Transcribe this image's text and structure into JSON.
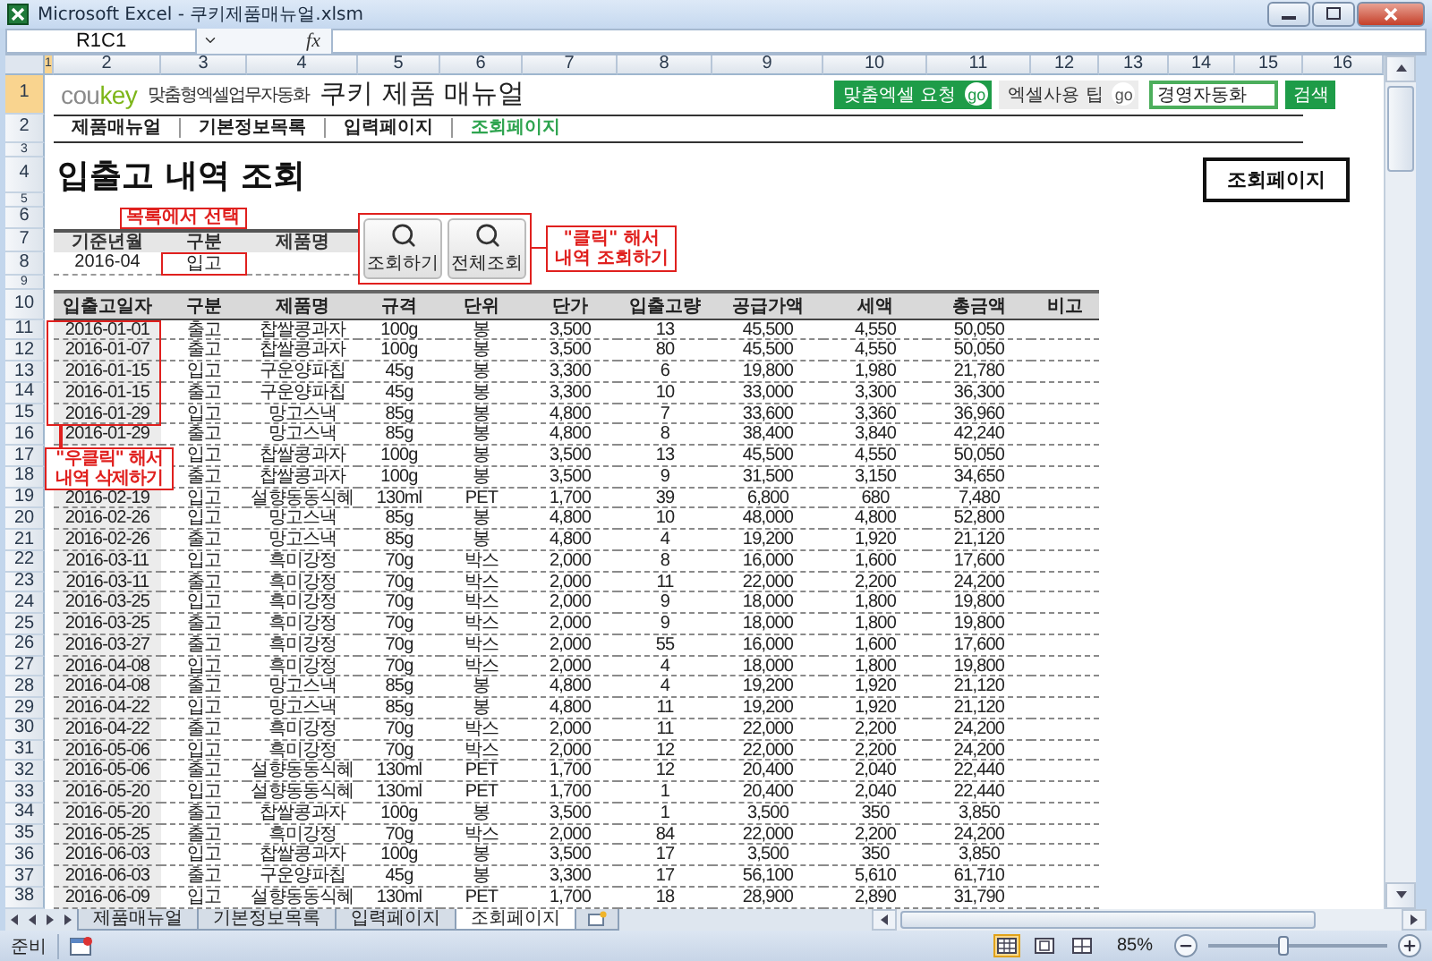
{
  "window": {
    "title": "Microsoft Excel - 쿠키제품매뉴얼.xlsm"
  },
  "formula_bar": {
    "name_box": "R1C1",
    "fx": "fx"
  },
  "column_headers": [
    {
      "label": "1",
      "selected": true
    },
    {
      "label": "2",
      "selected": false
    },
    {
      "label": "3",
      "selected": false
    },
    {
      "label": "4",
      "selected": false
    },
    {
      "label": "5",
      "selected": false
    },
    {
      "label": "6",
      "selected": false
    },
    {
      "label": "7",
      "selected": false
    },
    {
      "label": "8",
      "selected": false
    },
    {
      "label": "9",
      "selected": false
    },
    {
      "label": "10",
      "selected": false
    },
    {
      "label": "11",
      "selected": false
    },
    {
      "label": "12",
      "selected": false
    },
    {
      "label": "13",
      "selected": false
    },
    {
      "label": "14",
      "selected": false
    },
    {
      "label": "15",
      "selected": false
    },
    {
      "label": "16",
      "selected": false
    }
  ],
  "row_headers": [
    {
      "label": "1",
      "selected": true
    },
    {
      "label": "2",
      "selected": false
    },
    {
      "label": "3",
      "selected": false
    },
    {
      "label": "4",
      "selected": false
    },
    {
      "label": "5",
      "selected": false
    },
    {
      "label": "6",
      "selected": false
    },
    {
      "label": "7",
      "selected": false
    },
    {
      "label": "8",
      "selected": false
    },
    {
      "label": "9",
      "selected": false
    },
    {
      "label": "10",
      "selected": false
    },
    {
      "label": "11",
      "selected": false
    },
    {
      "label": "12",
      "selected": false
    },
    {
      "label": "13",
      "selected": false
    },
    {
      "label": "14",
      "selected": false
    },
    {
      "label": "15",
      "selected": false
    },
    {
      "label": "16",
      "selected": false
    },
    {
      "label": "17",
      "selected": false
    },
    {
      "label": "18",
      "selected": false
    },
    {
      "label": "19",
      "selected": false
    },
    {
      "label": "20",
      "selected": false
    },
    {
      "label": "21",
      "selected": false
    },
    {
      "label": "22",
      "selected": false
    },
    {
      "label": "23",
      "selected": false
    },
    {
      "label": "24",
      "selected": false
    },
    {
      "label": "25",
      "selected": false
    },
    {
      "label": "26",
      "selected": false
    },
    {
      "label": "27",
      "selected": false
    },
    {
      "label": "28",
      "selected": false
    },
    {
      "label": "29",
      "selected": false
    },
    {
      "label": "30",
      "selected": false
    },
    {
      "label": "31",
      "selected": false
    },
    {
      "label": "32",
      "selected": false
    },
    {
      "label": "33",
      "selected": false
    },
    {
      "label": "34",
      "selected": false
    },
    {
      "label": "35",
      "selected": false
    },
    {
      "label": "36",
      "selected": false
    },
    {
      "label": "37",
      "selected": false
    },
    {
      "label": "38",
      "selected": false
    }
  ],
  "brand": {
    "logo_part_1": "cou",
    "logo_part_2": "key",
    "tagline": "맞춤형엑셀업무자동화",
    "title": "쿠키 제품 매뉴얼"
  },
  "header_buttons": [
    {
      "kind": "green",
      "label": "맞춤엑셀 요청",
      "badge": "go"
    },
    {
      "kind": "gray",
      "label": "엑셀사용 팁",
      "badge": "go"
    }
  ],
  "search": {
    "value": "경영자동화",
    "button": "검색"
  },
  "nav": [
    {
      "label": "제품매뉴얼",
      "selected": false
    },
    {
      "label": "기본정보목록",
      "selected": false
    },
    {
      "label": "입력페이지",
      "selected": false
    },
    {
      "label": "조회페이지",
      "selected": true
    }
  ],
  "page_title": "입출고 내역 조회",
  "page_button": "조회페이지",
  "filter": {
    "fields": [
      {
        "header": "기준년월",
        "value": "2016-04",
        "highlighted": false
      },
      {
        "header": "구분",
        "value": "입고",
        "highlighted": true
      },
      {
        "header": "제품명",
        "highlighted": false
      }
    ],
    "note": "목록에서 선택"
  },
  "search_buttons": [
    {
      "label": "조회하기"
    },
    {
      "label": "전체조회"
    }
  ],
  "click_note": "\"클릭\" 해서\n내역 조회하기",
  "table": {
    "columns": [
      "입출고일자",
      "구분",
      "제품명",
      "규격",
      "단위",
      "단가",
      "입출고량",
      "공급가액",
      "세액",
      "총금액",
      "비고"
    ],
    "rows": [
      {
        "cells": [
          "2016-01-01",
          "출고",
          "찹쌀콩과자",
          "100g",
          "봉",
          "3,500",
          "13",
          "45,500",
          "4,550",
          "50,050"
        ]
      },
      {
        "cells": [
          "2016-01-07",
          "출고",
          "찹쌀콩과자",
          "100g",
          "봉",
          "3,500",
          "80",
          "45,500",
          "4,550",
          "50,050"
        ]
      },
      {
        "cells": [
          "2016-01-15",
          "입고",
          "구운양파칩",
          "45g",
          "봉",
          "3,300",
          "6",
          "19,800",
          "1,980",
          "21,780"
        ]
      },
      {
        "cells": [
          "2016-01-15",
          "출고",
          "구운양파칩",
          "45g",
          "봉",
          "3,300",
          "10",
          "33,000",
          "3,300",
          "36,300"
        ]
      },
      {
        "cells": [
          "2016-01-29",
          "입고",
          "망고스낵",
          "85g",
          "봉",
          "4,800",
          "7",
          "33,600",
          "3,360",
          "36,960"
        ]
      },
      {
        "cells": [
          "2016-01-29",
          "출고",
          "망고스낵",
          "85g",
          "봉",
          "4,800",
          "8",
          "38,400",
          "3,840",
          "42,240"
        ]
      },
      {
        "cells": [
          "",
          "입고",
          "찹쌀콩과자",
          "100g",
          "봉",
          "3,500",
          "13",
          "45,500",
          "4,550",
          "50,050"
        ]
      },
      {
        "cells": [
          "",
          "출고",
          "찹쌀콩과자",
          "100g",
          "봉",
          "3,500",
          "9",
          "31,500",
          "3,150",
          "34,650"
        ]
      },
      {
        "cells": [
          "2016-02-19",
          "입고",
          "설향동동식혜",
          "130ml",
          "PET",
          "1,700",
          "39",
          "6,800",
          "680",
          "7,480"
        ]
      },
      {
        "cells": [
          "2016-02-26",
          "입고",
          "망고스낵",
          "85g",
          "봉",
          "4,800",
          "10",
          "48,000",
          "4,800",
          "52,800"
        ]
      },
      {
        "cells": [
          "2016-02-26",
          "출고",
          "망고스낵",
          "85g",
          "봉",
          "4,800",
          "4",
          "19,200",
          "1,920",
          "21,120"
        ]
      },
      {
        "cells": [
          "2016-03-11",
          "입고",
          "흑미강정",
          "70g",
          "박스",
          "2,000",
          "8",
          "16,000",
          "1,600",
          "17,600"
        ]
      },
      {
        "cells": [
          "2016-03-11",
          "출고",
          "흑미강정",
          "70g",
          "박스",
          "2,000",
          "11",
          "22,000",
          "2,200",
          "24,200"
        ]
      },
      {
        "cells": [
          "2016-03-25",
          "입고",
          "흑미강정",
          "70g",
          "박스",
          "2,000",
          "9",
          "18,000",
          "1,800",
          "19,800"
        ]
      },
      {
        "cells": [
          "2016-03-25",
          "출고",
          "흑미강정",
          "70g",
          "박스",
          "2,000",
          "9",
          "18,000",
          "1,800",
          "19,800"
        ]
      },
      {
        "cells": [
          "2016-03-27",
          "출고",
          "흑미강정",
          "70g",
          "박스",
          "2,000",
          "55",
          "16,000",
          "1,600",
          "17,600"
        ]
      },
      {
        "cells": [
          "2016-04-08",
          "입고",
          "흑미강정",
          "70g",
          "박스",
          "2,000",
          "4",
          "18,000",
          "1,800",
          "19,800"
        ]
      },
      {
        "cells": [
          "2016-04-08",
          "출고",
          "망고스낵",
          "85g",
          "봉",
          "4,800",
          "4",
          "19,200",
          "1,920",
          "21,120"
        ]
      },
      {
        "cells": [
          "2016-04-22",
          "입고",
          "망고스낵",
          "85g",
          "봉",
          "4,800",
          "11",
          "19,200",
          "1,920",
          "21,120"
        ]
      },
      {
        "cells": [
          "2016-04-22",
          "출고",
          "흑미강정",
          "70g",
          "박스",
          "2,000",
          "11",
          "22,000",
          "2,200",
          "24,200"
        ]
      },
      {
        "cells": [
          "2016-05-06",
          "입고",
          "흑미강정",
          "70g",
          "박스",
          "2,000",
          "12",
          "22,000",
          "2,200",
          "24,200"
        ]
      },
      {
        "cells": [
          "2016-05-06",
          "출고",
          "설향동동식혜",
          "130ml",
          "PET",
          "1,700",
          "12",
          "20,400",
          "2,040",
          "22,440"
        ]
      },
      {
        "cells": [
          "2016-05-20",
          "입고",
          "설향동동식혜",
          "130ml",
          "PET",
          "1,700",
          "1",
          "20,400",
          "2,040",
          "22,440"
        ]
      },
      {
        "cells": [
          "2016-05-20",
          "출고",
          "찹쌀콩과자",
          "100g",
          "봉",
          "3,500",
          "1",
          "3,500",
          "350",
          "3,850"
        ]
      },
      {
        "cells": [
          "2016-05-25",
          "출고",
          "흑미강정",
          "70g",
          "박스",
          "2,000",
          "84",
          "22,000",
          "2,200",
          "24,200"
        ]
      },
      {
        "cells": [
          "2016-06-03",
          "입고",
          "찹쌀콩과자",
          "100g",
          "봉",
          "3,500",
          "17",
          "3,500",
          "350",
          "3,850"
        ]
      },
      {
        "cells": [
          "2016-06-03",
          "출고",
          "구운양파칩",
          "45g",
          "봉",
          "3,300",
          "17",
          "56,100",
          "5,610",
          "61,710"
        ]
      },
      {
        "cells": [
          "2016-06-09",
          "입고",
          "설향동동식혜",
          "130ml",
          "PET",
          "1,700",
          "18",
          "28,900",
          "2,890",
          "31,790"
        ]
      }
    ]
  },
  "delete_note": "\"우클릭\" 해서\n내역 삭제하기",
  "sheet_tabs": [
    {
      "label": "제품매뉴얼",
      "selected": false
    },
    {
      "label": "기본정보목록",
      "selected": false
    },
    {
      "label": "입력페이지",
      "selected": false
    },
    {
      "label": "조회페이지",
      "selected": true
    }
  ],
  "status_bar": {
    "status": "준비",
    "zoom": "85%",
    "zoom_slider": {
      "level": 0.42
    }
  }
}
